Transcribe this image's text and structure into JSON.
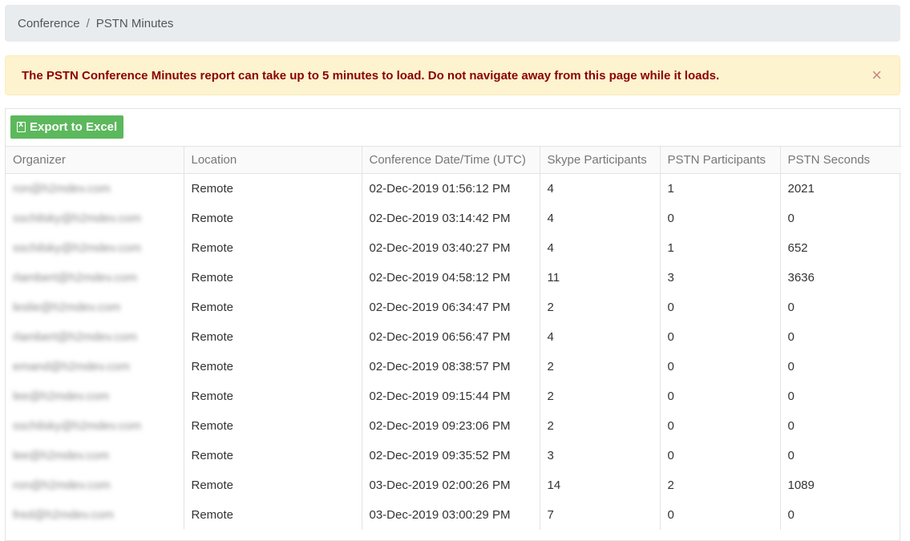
{
  "breadcrumb": {
    "items": [
      "Conference",
      "PSTN Minutes"
    ],
    "separator": "/"
  },
  "alert": {
    "message": "The PSTN Conference Minutes report can take up to 5 minutes to load. Do not navigate away from this page while it loads.",
    "close_label": "×"
  },
  "toolbar": {
    "export_label": "Export to Excel",
    "export_icon": "file-excel-icon"
  },
  "table": {
    "columns": [
      "Organizer",
      "Location",
      "Conference Date/Time (UTC)",
      "Skype Participants",
      "PSTN Participants",
      "PSTN Seconds"
    ],
    "rows": [
      {
        "organizer": "ron@h2mdev.com",
        "location": "Remote",
        "datetime": "02-Dec-2019 01:56:12 PM",
        "skype": "4",
        "pstn": "1",
        "seconds": "2021"
      },
      {
        "organizer": "sschilsky@h2mdev.com",
        "location": "Remote",
        "datetime": "02-Dec-2019 03:14:42 PM",
        "skype": "4",
        "pstn": "0",
        "seconds": "0"
      },
      {
        "organizer": "sschilsky@h2mdev.com",
        "location": "Remote",
        "datetime": "02-Dec-2019 03:40:27 PM",
        "skype": "4",
        "pstn": "1",
        "seconds": "652"
      },
      {
        "organizer": "rlambert@h2mdev.com",
        "location": "Remote",
        "datetime": "02-Dec-2019 04:58:12 PM",
        "skype": "11",
        "pstn": "3",
        "seconds": "3636"
      },
      {
        "organizer": "leslie@h2mdev.com",
        "location": "Remote",
        "datetime": "02-Dec-2019 06:34:47 PM",
        "skype": "2",
        "pstn": "0",
        "seconds": "0"
      },
      {
        "organizer": "rlambert@h2mdev.com",
        "location": "Remote",
        "datetime": "02-Dec-2019 06:56:47 PM",
        "skype": "4",
        "pstn": "0",
        "seconds": "0"
      },
      {
        "organizer": "emand@h2mdev.com",
        "location": "Remote",
        "datetime": "02-Dec-2019 08:38:57 PM",
        "skype": "2",
        "pstn": "0",
        "seconds": "0"
      },
      {
        "organizer": "lee@h2mdev.com",
        "location": "Remote",
        "datetime": "02-Dec-2019 09:15:44 PM",
        "skype": "2",
        "pstn": "0",
        "seconds": "0"
      },
      {
        "organizer": "sschilsky@h2mdev.com",
        "location": "Remote",
        "datetime": "02-Dec-2019 09:23:06 PM",
        "skype": "2",
        "pstn": "0",
        "seconds": "0"
      },
      {
        "organizer": "lee@h2mdev.com",
        "location": "Remote",
        "datetime": "02-Dec-2019 09:35:52 PM",
        "skype": "3",
        "pstn": "0",
        "seconds": "0"
      },
      {
        "organizer": "ron@h2mdev.com",
        "location": "Remote",
        "datetime": "03-Dec-2019 02:00:26 PM",
        "skype": "14",
        "pstn": "2",
        "seconds": "1089"
      },
      {
        "organizer": "fred@h2mdev.com",
        "location": "Remote",
        "datetime": "03-Dec-2019 03:00:29 PM",
        "skype": "7",
        "pstn": "0",
        "seconds": "0"
      }
    ]
  }
}
